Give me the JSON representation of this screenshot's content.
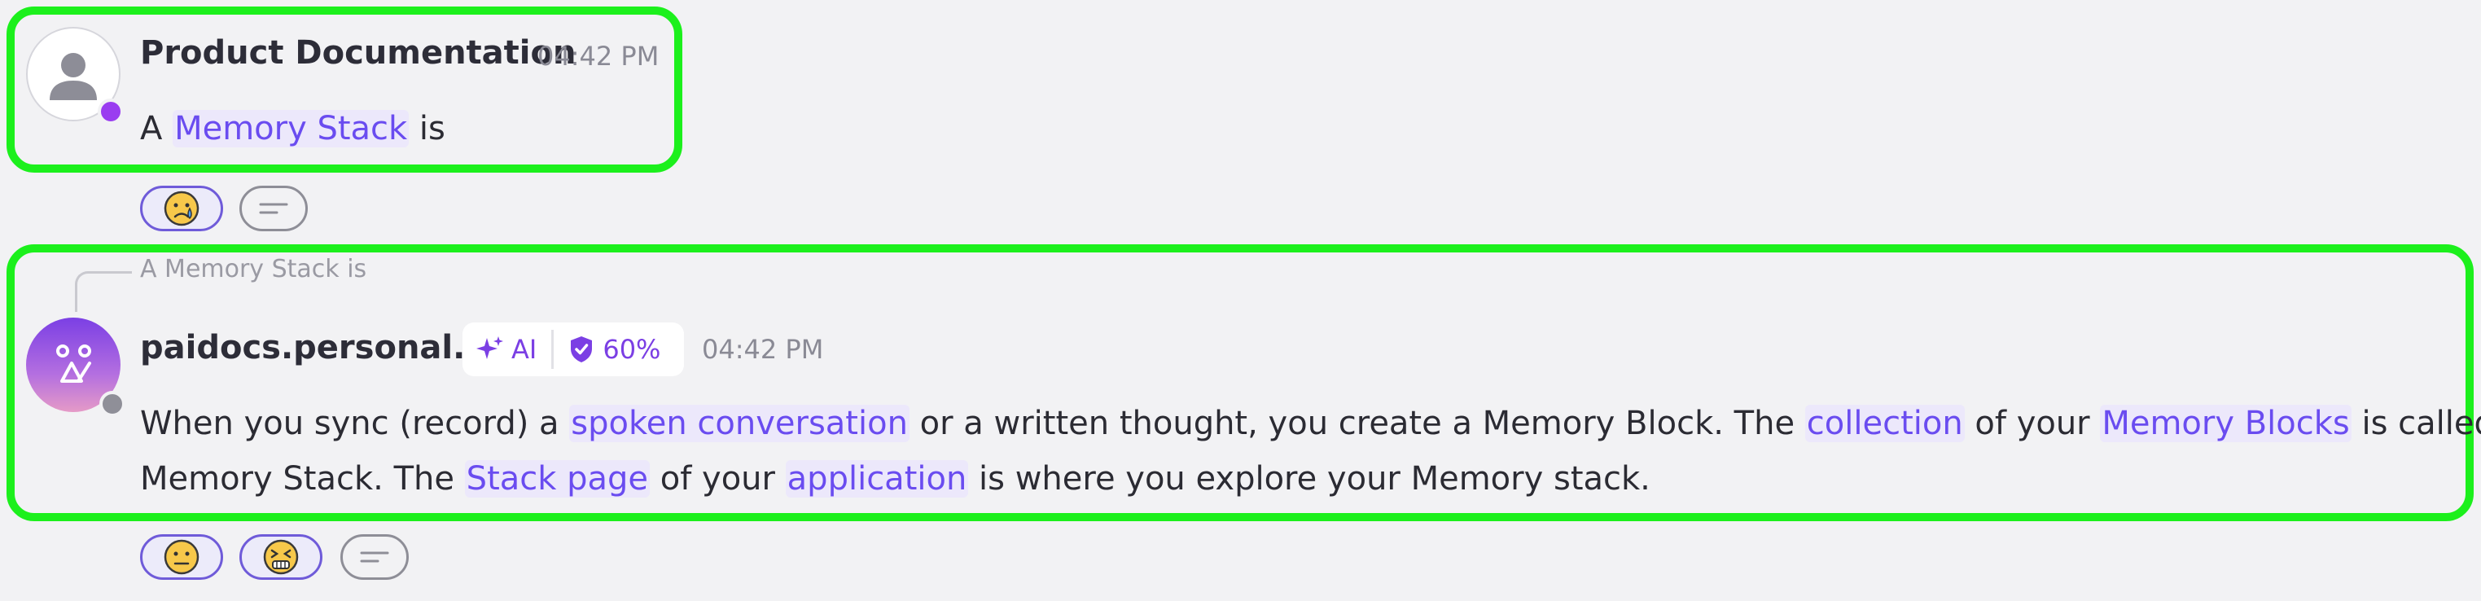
{
  "messages": [
    {
      "author": "Product Documentation",
      "time": "04:42 PM",
      "text_parts": [
        "A ",
        "Memory Stack",
        " is"
      ],
      "reactions": [
        "sad-tear-emoji",
        "reply-lines-icon"
      ]
    },
    {
      "reply_to": "A Memory Stack is",
      "author": "paidocs.personal.ai",
      "ai_label": "AI",
      "confidence": "60%",
      "time": "04:42 PM",
      "line1": [
        "When you sync (record) a ",
        "spoken conversation",
        " or a written thought, you create a Memory Block. The ",
        "collection",
        " of your ",
        "Memory Blocks",
        " is called your"
      ],
      "line2": [
        "Memory Stack. The ",
        "Stack page",
        " of your ",
        "application",
        " is where you explore your Memory stack."
      ],
      "reactions": [
        "neutral-face-emoji",
        "grimace-face-emoji",
        "reply-lines-icon"
      ]
    }
  ],
  "colors": {
    "highlight": "#1cf01c",
    "link": "#6a4cf0",
    "ai_accent": "#7b3fe4",
    "online_dot": "#9a3df0",
    "offline_dot": "#8f8f98"
  }
}
